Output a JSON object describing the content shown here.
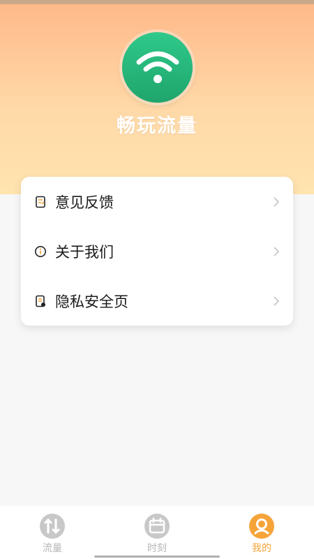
{
  "app": {
    "name": "畅玩流量"
  },
  "colors": {
    "accent": "#f6a43a",
    "logo_green": "#27b87a",
    "inactive": "#b5b5b5"
  },
  "menu": {
    "items": [
      {
        "label": "意见反馈",
        "icon": "feedback-icon"
      },
      {
        "label": "关于我们",
        "icon": "info-icon"
      },
      {
        "label": "隐私安全页",
        "icon": "privacy-icon"
      }
    ]
  },
  "tabs": [
    {
      "label": "流量",
      "icon": "traffic-icon",
      "active": false
    },
    {
      "label": "时刻",
      "icon": "calendar-icon",
      "active": false
    },
    {
      "label": "我的",
      "icon": "profile-icon",
      "active": true
    }
  ]
}
